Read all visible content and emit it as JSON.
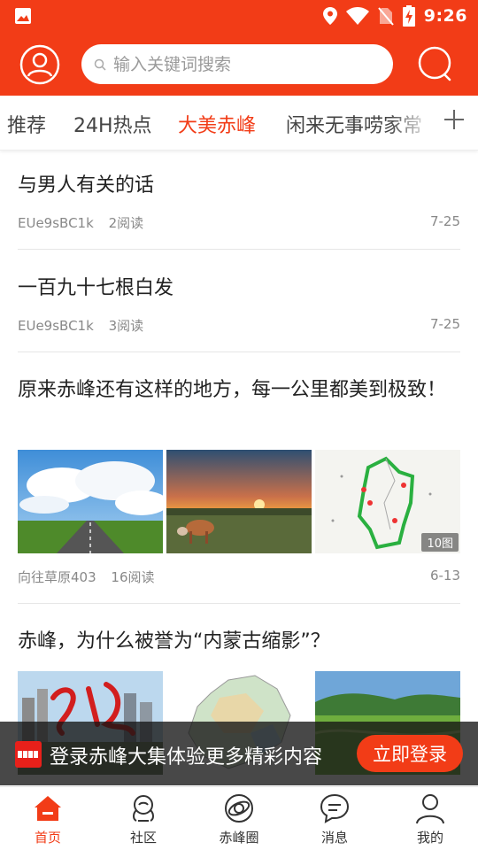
{
  "status_bar": {
    "time": "9:26"
  },
  "search": {
    "placeholder": "输入关键词搜索"
  },
  "tabs": [
    {
      "label": "推荐"
    },
    {
      "label": "24H热点"
    },
    {
      "label": "大美赤峰"
    },
    {
      "label": "闲来无事唠家常"
    }
  ],
  "articles": [
    {
      "title": "与男人有关的话",
      "author": "EUe9sBC1k",
      "reads": "2阅读",
      "date": "7-25"
    },
    {
      "title": "一百九十七根白发",
      "author": "EUe9sBC1k",
      "reads": "3阅读",
      "date": "7-25"
    },
    {
      "title": "原来赤峰还有这样的地方，每一公里都美到极致！",
      "author": "向往草原403",
      "reads": "16阅读",
      "date": "6-13",
      "image_count": "10图"
    },
    {
      "title": "赤峰，为什么被誉为“内蒙古缩影”？"
    }
  ],
  "login_banner": {
    "logo_text": "赤峰大集",
    "text": "登录赤峰大集体验更多精彩内容",
    "button": "立即登录"
  },
  "bottom_nav": [
    {
      "label": "首页"
    },
    {
      "label": "社区"
    },
    {
      "label": "赤峰圈"
    },
    {
      "label": "消息"
    },
    {
      "label": "我的"
    }
  ],
  "colors": {
    "accent": "#f23c17"
  }
}
